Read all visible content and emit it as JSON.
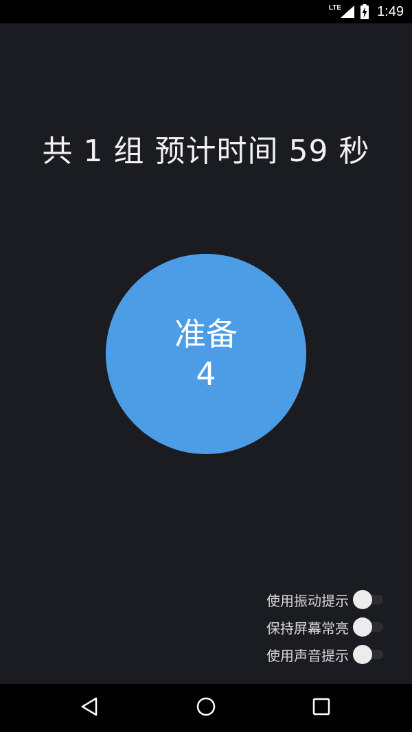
{
  "status_bar": {
    "network": "LTE",
    "time": "1:49",
    "icons": [
      "signal-icon",
      "battery-charging-icon"
    ]
  },
  "main": {
    "summary": "共 1 组 预计时间 59 秒",
    "circle": {
      "label": "准备",
      "count": "4",
      "color": "#4d9de6"
    }
  },
  "settings": [
    {
      "label": "使用振动提示",
      "enabled": false
    },
    {
      "label": "保持屏幕常亮",
      "enabled": false
    },
    {
      "label": "使用声音提示",
      "enabled": false
    }
  ],
  "nav_bar": {
    "icons": [
      "back-icon",
      "home-icon",
      "recents-icon"
    ]
  },
  "colors": {
    "background": "#1b1c22",
    "accent": "#4d9de6",
    "text": "#f2f2f2"
  }
}
